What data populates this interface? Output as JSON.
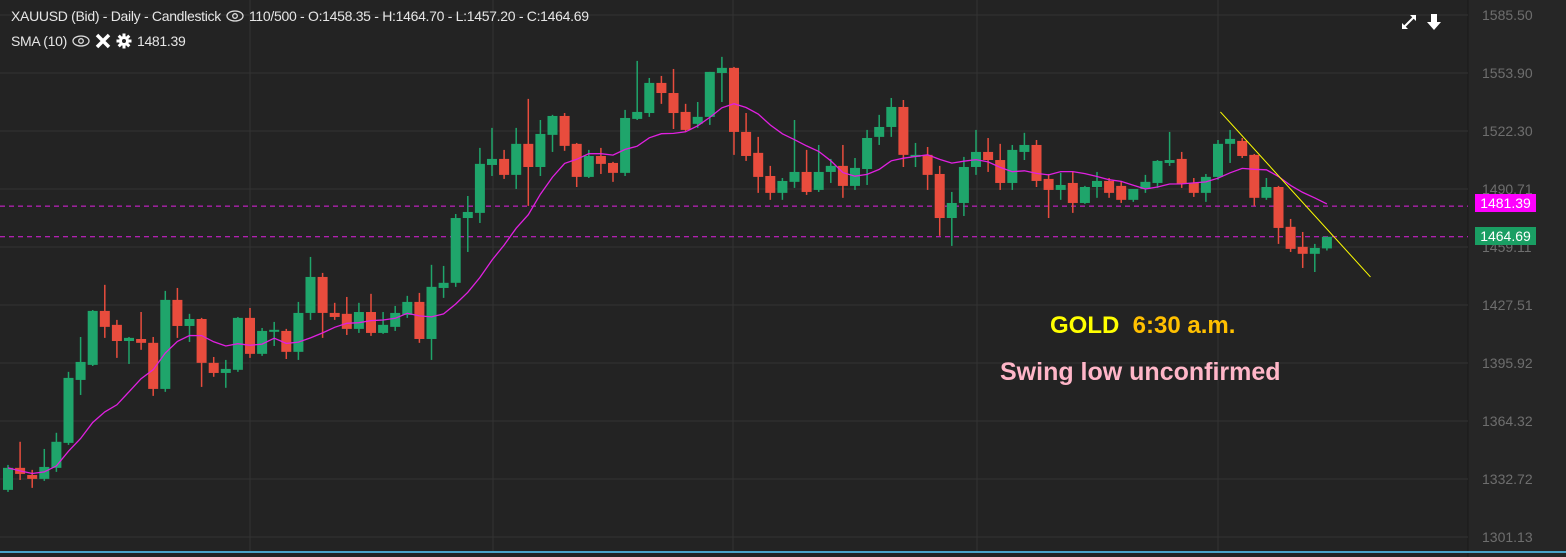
{
  "header": {
    "symbol_line": "XAUUSD (Bid) - Daily - Candlestick",
    "bar_info": "110/500 - O:1458.35 - H:1464.70 - L:1457.20 - C:1464.69",
    "indicator_label": "SMA (10)",
    "indicator_value": "1481.39",
    "icons": [
      "eye-icon",
      "close-icon",
      "gear-icon",
      "expand-icon",
      "download-icon"
    ]
  },
  "annotations": {
    "title_a": "GOLD",
    "title_b": "6:30 a.m.",
    "subtitle": "Swing low unconfirmed"
  },
  "price_tags": {
    "sma": "1481.39",
    "last": "1464.69"
  },
  "colors": {
    "background": "#232323",
    "up": "#1fa56b",
    "down": "#e84c3d",
    "sma": "#e020e0",
    "sma_tag": "#ff00ff",
    "last_tag": "#1a9e63",
    "trendline": "#ffff00",
    "title_a": "#ffff00",
    "title_b": "#ffc000",
    "subtitle": "#ffb6c8"
  },
  "chart_data": {
    "type": "candlestick",
    "symbol": "XAUUSD",
    "timeframe": "Daily",
    "bars_shown": 110,
    "bars_total": 500,
    "y_ticks": [
      "1585.50",
      "1553.90",
      "1522.30",
      "1490.71",
      "1459.11",
      "1427.51",
      "1395.92",
      "1364.32",
      "1332.72",
      "1301.13"
    ],
    "ylim": [
      1301.13,
      1585.5
    ],
    "grid": true,
    "sma_period": 10,
    "sma_last": 1481.39,
    "last_close": 1464.69,
    "ohlc": [
      [
        1326.8,
        1340.4,
        1325.7,
        1338.8
      ],
      [
        1338.8,
        1353.0,
        1332.2,
        1335.5
      ],
      [
        1334.9,
        1337.7,
        1327.9,
        1332.8
      ],
      [
        1332.8,
        1349.1,
        1331.7,
        1339.3
      ],
      [
        1338.8,
        1357.9,
        1336.6,
        1353.0
      ],
      [
        1352.4,
        1391.1,
        1351.3,
        1387.8
      ],
      [
        1386.7,
        1410.1,
        1378.5,
        1396.5
      ],
      [
        1394.9,
        1424.8,
        1394.3,
        1424.3
      ],
      [
        1424.3,
        1438.5,
        1409.6,
        1415.6
      ],
      [
        1416.7,
        1419.4,
        1398.7,
        1407.9
      ],
      [
        1407.9,
        1410.1,
        1395.4,
        1409.6
      ],
      [
        1409.0,
        1423.7,
        1403.1,
        1406.9
      ],
      [
        1406.9,
        1410.1,
        1378.0,
        1381.8
      ],
      [
        1381.8,
        1435.2,
        1380.2,
        1430.3
      ],
      [
        1430.3,
        1436.8,
        1409.6,
        1416.1
      ],
      [
        1416.1,
        1422.7,
        1407.4,
        1419.9
      ],
      [
        1419.9,
        1420.5,
        1382.9,
        1396.0
      ],
      [
        1396.0,
        1399.2,
        1388.4,
        1390.5
      ],
      [
        1390.5,
        1397.6,
        1382.4,
        1392.7
      ],
      [
        1392.2,
        1421.0,
        1391.1,
        1420.5
      ],
      [
        1420.5,
        1425.9,
        1398.7,
        1400.9
      ],
      [
        1400.9,
        1415.0,
        1399.8,
        1413.4
      ],
      [
        1412.9,
        1418.3,
        1405.2,
        1414.0
      ],
      [
        1413.4,
        1414.5,
        1398.1,
        1402.0
      ],
      [
        1402.0,
        1429.2,
        1397.6,
        1423.2
      ],
      [
        1423.2,
        1453.7,
        1419.4,
        1442.8
      ],
      [
        1442.8,
        1445.0,
        1409.6,
        1423.2
      ],
      [
        1423.2,
        1428.7,
        1419.4,
        1421.0
      ],
      [
        1422.7,
        1431.9,
        1411.2,
        1414.5
      ],
      [
        1414.5,
        1428.7,
        1412.3,
        1423.7
      ],
      [
        1423.7,
        1433.6,
        1410.7,
        1412.3
      ],
      [
        1412.3,
        1423.7,
        1411.8,
        1416.7
      ],
      [
        1415.6,
        1427.0,
        1413.4,
        1423.2
      ],
      [
        1422.1,
        1432.5,
        1420.5,
        1429.2
      ],
      [
        1429.2,
        1434.1,
        1406.9,
        1409.0
      ],
      [
        1409.0,
        1449.4,
        1397.6,
        1437.4
      ],
      [
        1436.8,
        1448.8,
        1431.4,
        1439.6
      ],
      [
        1439.6,
        1477.1,
        1437.4,
        1474.9
      ],
      [
        1474.9,
        1486.9,
        1456.4,
        1478.2
      ],
      [
        1477.7,
        1513.1,
        1472.2,
        1504.4
      ],
      [
        1503.8,
        1524.0,
        1497.8,
        1507.1
      ],
      [
        1507.1,
        1512.0,
        1496.2,
        1498.4
      ],
      [
        1498.4,
        1524.0,
        1490.7,
        1515.3
      ],
      [
        1515.3,
        1539.8,
        1481.5,
        1502.7
      ],
      [
        1502.7,
        1528.3,
        1497.8,
        1520.7
      ],
      [
        1520.2,
        1531.1,
        1510.9,
        1530.5
      ],
      [
        1530.5,
        1532.1,
        1511.5,
        1514.2
      ],
      [
        1515.3,
        1515.8,
        1491.8,
        1497.3
      ],
      [
        1497.3,
        1512.0,
        1496.7,
        1508.7
      ],
      [
        1508.7,
        1513.1,
        1498.9,
        1504.4
      ],
      [
        1504.9,
        1505.5,
        1494.6,
        1499.5
      ],
      [
        1499.5,
        1533.8,
        1497.8,
        1529.4
      ],
      [
        1528.9,
        1560.5,
        1528.3,
        1532.7
      ],
      [
        1532.1,
        1551.2,
        1530.0,
        1548.5
      ],
      [
        1548.5,
        1552.3,
        1537.1,
        1543.0
      ],
      [
        1543.0,
        1556.1,
        1523.4,
        1532.1
      ],
      [
        1532.7,
        1537.1,
        1521.8,
        1522.9
      ],
      [
        1526.2,
        1538.1,
        1524.0,
        1530.0
      ],
      [
        1530.0,
        1554.5,
        1525.6,
        1554.5
      ],
      [
        1553.9,
        1562.7,
        1538.1,
        1556.7
      ],
      [
        1556.7,
        1557.2,
        1509.3,
        1521.8
      ],
      [
        1521.8,
        1532.1,
        1506.0,
        1508.7
      ],
      [
        1510.4,
        1519.1,
        1488.6,
        1497.3
      ],
      [
        1497.8,
        1503.3,
        1484.8,
        1488.6
      ],
      [
        1488.6,
        1496.7,
        1484.8,
        1495.1
      ],
      [
        1494.6,
        1528.3,
        1491.3,
        1500.0
      ],
      [
        1500.0,
        1512.0,
        1487.5,
        1489.1
      ],
      [
        1490.2,
        1514.7,
        1489.1,
        1500.0
      ],
      [
        1500.0,
        1507.1,
        1494.0,
        1503.3
      ],
      [
        1503.3,
        1514.7,
        1485.9,
        1492.4
      ],
      [
        1492.4,
        1507.6,
        1490.2,
        1502.2
      ],
      [
        1501.6,
        1522.9,
        1492.9,
        1518.5
      ],
      [
        1519.1,
        1531.1,
        1514.7,
        1524.5
      ],
      [
        1524.5,
        1540.3,
        1519.1,
        1535.4
      ],
      [
        1535.4,
        1539.2,
        1502.7,
        1509.3
      ],
      [
        1508.2,
        1515.8,
        1502.7,
        1509.3
      ],
      [
        1509.3,
        1513.6,
        1490.2,
        1498.4
      ],
      [
        1498.9,
        1503.3,
        1465.2,
        1474.9
      ],
      [
        1474.9,
        1489.1,
        1459.7,
        1483.1
      ],
      [
        1483.1,
        1508.2,
        1476.0,
        1502.7
      ],
      [
        1502.7,
        1522.9,
        1498.4,
        1510.9
      ],
      [
        1510.9,
        1518.5,
        1500.0,
        1506.5
      ],
      [
        1506.5,
        1515.3,
        1490.2,
        1494.0
      ],
      [
        1494.0,
        1514.7,
        1490.2,
        1512.0
      ],
      [
        1510.9,
        1521.3,
        1506.5,
        1514.7
      ],
      [
        1514.7,
        1517.4,
        1491.8,
        1495.1
      ],
      [
        1496.2,
        1498.9,
        1474.9,
        1490.2
      ],
      [
        1490.2,
        1499.5,
        1484.8,
        1492.9
      ],
      [
        1494.0,
        1500.0,
        1477.7,
        1483.1
      ],
      [
        1483.1,
        1492.4,
        1482.6,
        1491.8
      ],
      [
        1491.8,
        1500.0,
        1485.9,
        1495.1
      ],
      [
        1495.1,
        1496.7,
        1485.9,
        1488.6
      ],
      [
        1492.4,
        1495.1,
        1483.1,
        1484.8
      ],
      [
        1484.8,
        1490.7,
        1483.7,
        1490.7
      ],
      [
        1490.7,
        1498.4,
        1488.6,
        1494.6
      ],
      [
        1494.0,
        1506.5,
        1491.3,
        1506.0
      ],
      [
        1504.9,
        1521.8,
        1503.3,
        1506.5
      ],
      [
        1507.1,
        1510.9,
        1491.3,
        1493.5
      ],
      [
        1494.0,
        1496.7,
        1486.4,
        1488.6
      ],
      [
        1488.6,
        1498.9,
        1483.7,
        1497.3
      ],
      [
        1497.3,
        1517.4,
        1495.7,
        1515.3
      ],
      [
        1515.3,
        1522.9,
        1504.9,
        1518.0
      ],
      [
        1516.9,
        1518.5,
        1507.6,
        1508.7
      ],
      [
        1509.3,
        1509.8,
        1481.5,
        1485.9
      ],
      [
        1485.9,
        1496.7,
        1484.8,
        1491.8
      ],
      [
        1491.8,
        1492.4,
        1460.8,
        1469.5
      ],
      [
        1470.1,
        1474.4,
        1456.4,
        1458.1
      ],
      [
        1459.2,
        1467.3,
        1447.7,
        1455.4
      ],
      [
        1455.4,
        1460.8,
        1445.5,
        1458.6
      ],
      [
        1458.35,
        1464.7,
        1457.2,
        1464.69
      ]
    ],
    "horizontal_lines": [
      1481.39,
      1464.69
    ],
    "trendline": {
      "from": {
        "bar": 100.2,
        "price": 1532.7
      },
      "to": {
        "bar": 112.6,
        "price": 1442.8
      }
    }
  }
}
